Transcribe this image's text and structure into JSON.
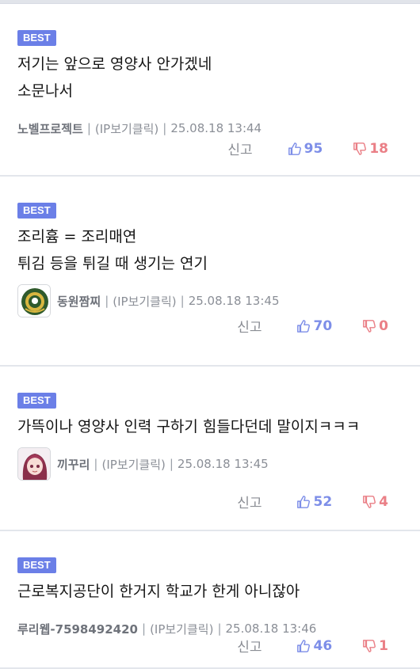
{
  "comments": [
    {
      "badge": "BEST",
      "text": "저기는 앞으로 영양사 안가겠네\n소문나서",
      "author": "노벨프로젝트",
      "ip": "(IP보기클릭)",
      "date": "25.08.18 13:44",
      "report": "신고",
      "likes": "95",
      "dislikes": "18"
    },
    {
      "badge": "BEST",
      "text": "조리흄 = 조리매연\n튀김 등을 튀길 때 생기는 연기",
      "author": "동원짬찌",
      "ip": "(IP보기클릭)",
      "date": "25.08.18 13:45",
      "report": "신고",
      "likes": "70",
      "dislikes": "0"
    },
    {
      "badge": "BEST",
      "text": "가뜩이나 영양사 인력 구하기 힘들다던데 말이지ㅋㅋㅋ",
      "author": "끼꾸리",
      "ip": "(IP보기클릭)",
      "date": "25.08.18 13:45",
      "report": "신고",
      "likes": "52",
      "dislikes": "4"
    },
    {
      "badge": "BEST",
      "text": "근로복지공단이 한거지 학교가 한게 아니잖아",
      "author": "루리웹-7598492420",
      "ip": "(IP보기클릭)",
      "date": "25.08.18 13:46",
      "report": "신고",
      "likes": "46",
      "dislikes": "1"
    }
  ],
  "separator": "|",
  "colors": {
    "badge": "#6b7fe7",
    "like": "#7d8ee8",
    "dislike": "#ea7f86"
  }
}
